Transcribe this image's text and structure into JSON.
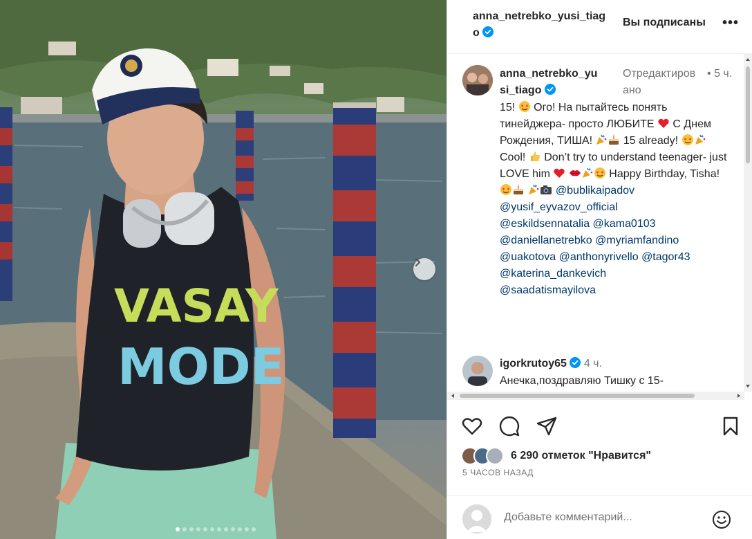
{
  "post": {
    "header_username": "anna_netrebko_yusi_tiago",
    "follow_status": "Вы подписаны",
    "more_icon": "more-horizontal-icon"
  },
  "caption": {
    "username": "anna_netrebko_yusi_tiago",
    "edited_label": "Отредактировано",
    "dot": "•",
    "time": "5 ч.",
    "text_parts": {
      "p1": "15! ",
      "p2": " Ого! На пытайтесь понять тинейджера- просто ЛЮБИТЕ ",
      "p3": " С Днем Рождения, ТИША! ",
      "p4": " 15 already! ",
      "p5": " Cool! ",
      "p6": " Don’t try to understand teenager- just LOVE him ",
      "p7": " Happy Birthday, Tisha! ",
      "p8": " "
    },
    "mentions": [
      "@bublikaipadov",
      "@yusif_eyvazov_official",
      "@eskildsennatalia",
      "@kama0103",
      "@daniellanetrebko",
      "@myriamfandino",
      "@uakotova",
      "@anthonyrivello",
      "@tagor43",
      "@katerina_dankevich",
      "@saadatismayilova"
    ]
  },
  "comment2": {
    "username": "igorkrutoy65",
    "time": "4 ч.",
    "text": "Анечка,поздравляю Тишку с 15-"
  },
  "likes": {
    "text": "6 290 отметок \"Нравится\""
  },
  "ago": "5 ЧАСОВ НАЗАД",
  "add_comment": {
    "placeholder": "Добавьте комментарий..."
  },
  "icons": {
    "like": "heart-icon",
    "comment": "comment-icon",
    "share": "share-icon",
    "save": "bookmark-icon",
    "emoji": "smile-icon"
  },
  "colors": {
    "verified": "#0095f6",
    "mention": "#00376b",
    "secondary": "#737373"
  }
}
